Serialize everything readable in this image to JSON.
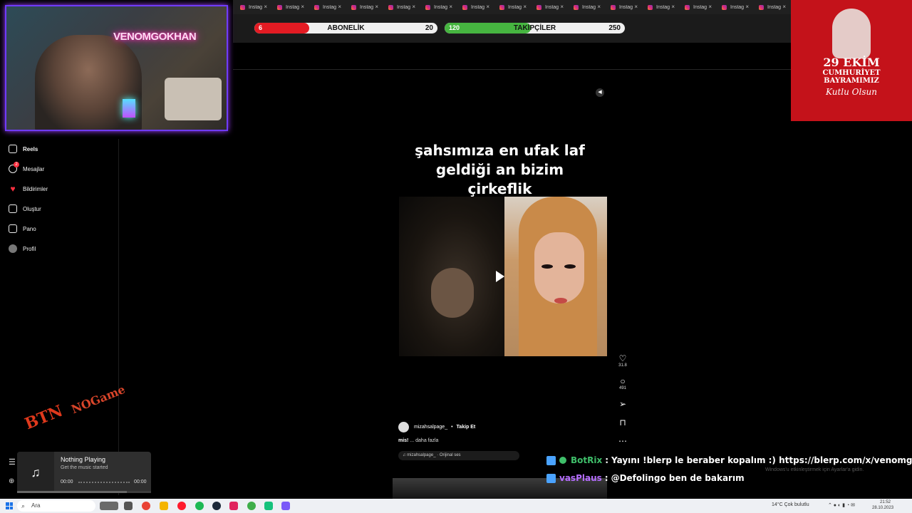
{
  "tabs": {
    "label": "Instag",
    "count": 15,
    "close": "×"
  },
  "goals": [
    {
      "start": "6",
      "label": "ABONELİK",
      "end": "20",
      "fill_fraction": 0.3,
      "color": "#e31b23"
    },
    {
      "start": "120",
      "label": "TAKİPÇİLER",
      "end": "250",
      "fill_fraction": 0.48,
      "color": "#46b540"
    }
  ],
  "webcam": {
    "neon_text": "VENOMGOKHAN"
  },
  "banner": {
    "line1": "29 EKİM",
    "line2a": "CUMHURİYET",
    "line2b": "BAYRAMIMIZ",
    "line3": "Kutlu Olsun"
  },
  "sidebar": {
    "items": [
      {
        "label": "Reels",
        "icon": "reels-icon"
      },
      {
        "label": "Mesajlar",
        "icon": "messenger-icon",
        "badge": "2"
      },
      {
        "label": "Bildirimler",
        "icon": "heart-icon"
      },
      {
        "label": "Oluştur",
        "icon": "plus-icon"
      },
      {
        "label": "Pano",
        "icon": "dashboard-icon"
      },
      {
        "label": "Profil",
        "icon": "avatar-icon"
      }
    ]
  },
  "reel": {
    "caption_l1": "şahsımıza en ufak laf",
    "caption_l2": "geldiği an bizim",
    "caption_l3": "çirkeflik",
    "likes": "31.8",
    "comments": "491",
    "author": "mizahsalpage_",
    "dot": "•",
    "follow": "Takip Et",
    "desc_user": "mis!",
    "desc_more": "... daha fazla",
    "audio": "♫ mizahsalpage_ · Orijinal ses"
  },
  "logo": {
    "text1": "BTN",
    "text2": "NOGame"
  },
  "music": {
    "title": "Nothing Playing",
    "subtitle": "Get the music started",
    "time_start": "00:00",
    "time_end": "00:00",
    "progress": 0.82
  },
  "chat": [
    {
      "user": "BotRix",
      "user_color": "#3fbf6a",
      "sep": ":",
      "message": "Yayını !blerp le beraber kopalım :) https://blerp.com/x/venomgokhan",
      "verified": true
    },
    {
      "user": "vasPlaus",
      "user_color": "#b56cff",
      "sep": ":",
      "message": "@Defolingo ben de bakarım",
      "verified": false
    }
  ],
  "windows_activate": "Windows'u etkinleştirmek için Ayarlar'a gidin.",
  "taskbar": {
    "search": "Ara",
    "weather": "14°C  Çok bulutlu",
    "time": "21:52",
    "date": "28.10.2023"
  }
}
